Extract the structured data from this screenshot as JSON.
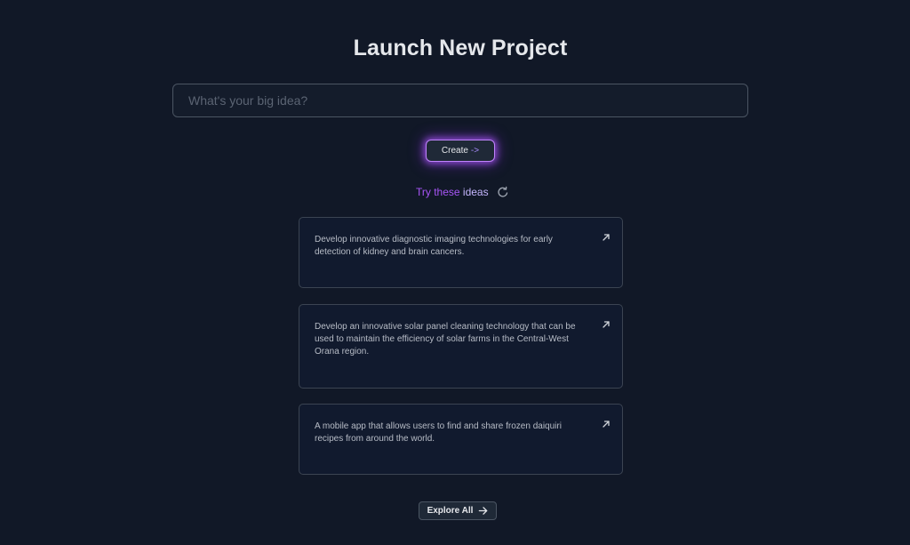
{
  "header": {
    "title": "Launch New Project"
  },
  "search": {
    "value": "",
    "placeholder": "What's your big idea?"
  },
  "create_button": {
    "label": "Create",
    "arrow": "->"
  },
  "suggestions": {
    "label_part1": "Try these",
    "label_part2": "ideas",
    "refresh_icon": "refresh-icon",
    "items": [
      {
        "text": "Develop innovative diagnostic imaging technologies for early detection of kidney and brain cancers.",
        "icon": "arrow-up-right-icon"
      },
      {
        "text": "Develop an innovative solar panel cleaning technology that can be used to maintain the efficiency of solar farms in the Central-West Orana region.",
        "icon": "arrow-up-right-icon"
      },
      {
        "text": "A mobile app that allows users to find and share frozen daiquiri recipes from around the world.",
        "icon": "arrow-up-right-icon"
      }
    ]
  },
  "explore_button": {
    "label": "Explore All",
    "icon": "arrow-right-icon"
  },
  "colors": {
    "background": "#111827",
    "accent_purple": "#a855f7",
    "card_border": "#3b4452"
  }
}
